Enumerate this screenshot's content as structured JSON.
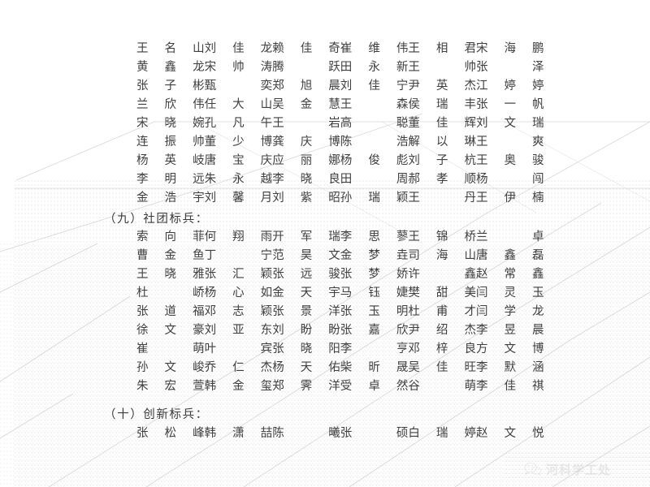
{
  "document": {
    "type": "scanned-notice-page",
    "language": "zh-CN",
    "background_color": "#ffffff",
    "text_color": "#3c3c3c"
  },
  "name_columns": 6,
  "blocks": [
    {
      "id": "block-top-names",
      "heading": null,
      "rows": [
        [
          "王名山",
          "刘佳龙",
          "赖佳奇",
          "崔维伟",
          "王相君",
          "宋海鹏"
        ],
        [
          "黄鑫龙",
          "宋帅涛",
          "腾跃",
          "田永新",
          "王帅",
          "张泽"
        ],
        [
          "张子彬",
          "甄奕",
          "郑旭晨",
          "刘佳宁",
          "尹英杰",
          "江婷婷"
        ],
        [
          "兰欣伟",
          "任大山",
          "吴金慧",
          "王森",
          "侯瑞丰",
          "张一帆"
        ],
        [
          "宋晓婉",
          "孔凡午",
          "王岩",
          "高聪",
          "董佳辉",
          "刘文瑞"
        ],
        [
          "连振帅",
          "董少博",
          "龚庆博",
          "陈浩",
          "解以琳",
          "王爽"
        ],
        [
          "杨英岐",
          "唐宝庆",
          "应丽娜",
          "杨俊彪",
          "刘子杭",
          "王奥骏"
        ],
        [
          "李明远",
          "朱永越",
          "李晓良",
          "田周",
          "郝孝顺",
          "杨闯"
        ],
        [
          "金浩宇",
          "刘馨月",
          "刘紫昭",
          "孙瑞颖",
          "王丹",
          "王伊楠"
        ]
      ]
    },
    {
      "id": "block-shetuan",
      "heading": "（九）社团标兵：",
      "rows": [
        [
          "索向菲",
          "何翔雨",
          "开军瑞",
          "李思蓼",
          "王锦桥",
          "兰卓"
        ],
        [
          "曹金鱼",
          "丁宁",
          "范昊文",
          "金梦垚",
          "司海山",
          "唐鑫磊"
        ],
        [
          "王晓雅",
          "张汇颖",
          "张远骏",
          "张梦娇",
          "许鑫",
          "赵常鑫"
        ],
        [
          "杜峤",
          "杨心如",
          "金天宇",
          "马钰婕",
          "樊甜美",
          "闫灵玉"
        ],
        [
          "张道福",
          "邓志颖",
          "张景洋",
          "张玉明",
          "杜甫才",
          "闫学龙"
        ],
        [
          "徐文豪",
          "刘亚东",
          "刘盼盼",
          "张嘉欣",
          "尹绍杰",
          "李昱晨"
        ],
        [
          "崔萌",
          "叶宾",
          "张晓阳",
          "李亨",
          "邓梓良",
          "方文博"
        ],
        [
          "孙文峻",
          "乔仁杰",
          "杨天佑",
          "柴昕晟",
          "吴佳旺",
          "李默涵"
        ],
        [
          "朱宏萱",
          "韩金玺",
          "郑霁洋",
          "受卓然",
          "谷萌",
          "李佳祺"
        ]
      ]
    },
    {
      "id": "block-chuangxin",
      "heading": "（十）创新标兵：",
      "rows": [
        [
          "张松峰",
          "韩潇喆",
          "陈曦",
          "张硕",
          "白瑞婷",
          "赵文悦"
        ]
      ]
    }
  ],
  "watermark": {
    "icon": "wechat-icon",
    "text": "河科学工处",
    "color": "#b9b9bd"
  }
}
